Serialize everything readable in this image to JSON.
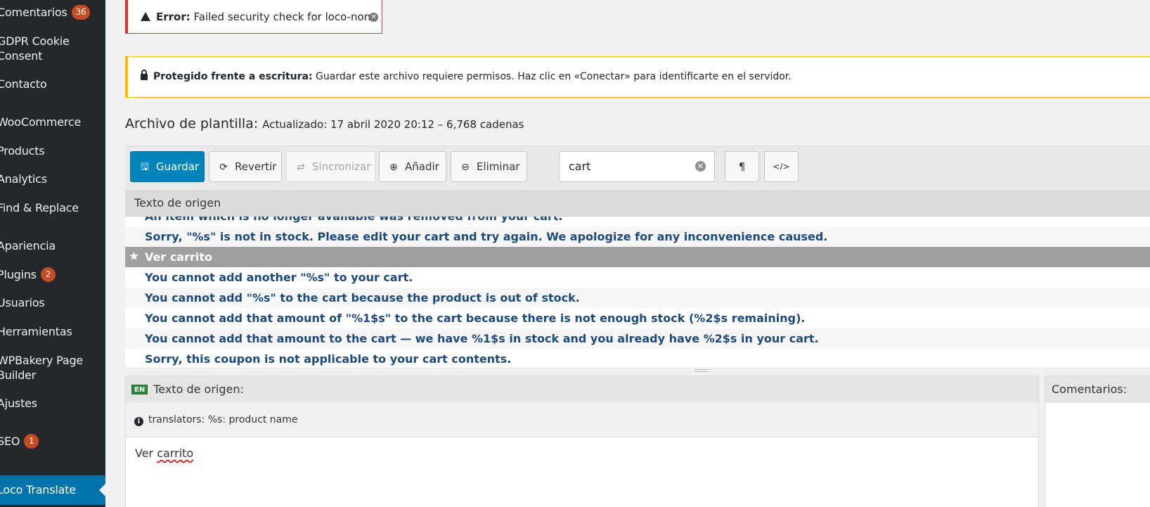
{
  "sidebar": {
    "items": [
      {
        "label": "Comentarios",
        "badge": "36"
      },
      {
        "label": "GDPR Cookie",
        "label2": "Consent"
      },
      {
        "label": "Contacto"
      },
      {
        "label": "WooCommerce"
      },
      {
        "label": "Products"
      },
      {
        "label": "Analytics"
      },
      {
        "label": "Find & Replace"
      },
      {
        "label": "Apariencia"
      },
      {
        "label": "Plugins",
        "badge": "2"
      },
      {
        "label": "Usuarios"
      },
      {
        "label": "Herramientas"
      },
      {
        "label": "WPBakery Page",
        "label2": "Builder"
      },
      {
        "label": "Ajustes"
      },
      {
        "label": "SEO",
        "badge": "1"
      },
      {
        "label": "Loco Translate"
      }
    ]
  },
  "notices": {
    "error_label": "Error:",
    "error_text": "Failed security check for loco-non",
    "warn_label": "Protegido frente a escritura:",
    "warn_text": "Guardar este archivo requiere permisos. Haz clic en «Conectar» para identificarte en el servidor."
  },
  "file": {
    "label": "Archivo de plantilla:",
    "meta": "Actualizado: 17 abril 2020 20:12 – 6,768 cadenas"
  },
  "toolbar": {
    "save": "Guardar",
    "revert": "Revertir",
    "sync": "Sincronizar",
    "add": "Añadir",
    "delete": "Eliminar",
    "search_value": "cart",
    "pilcrow": "¶",
    "code": "</>"
  },
  "list": {
    "header": "Texto de origen",
    "partial_row": "An item which is no longer available was removed from your cart.",
    "rows": [
      "Sorry, \"%s\" is not in stock. Please edit your cart and try again. We apologize for any inconvenience caused.",
      "Ver carrito",
      "You cannot add another \"%s\" to your cart.",
      "You cannot add \"%s\" to the cart because the product is out of stock.",
      "You cannot add that amount of \"%1$s\" to the cart because there is not enough stock (%2$s remaining).",
      "You cannot add that amount to the cart — we have %1$s in stock and you already have %2$s in your cart.",
      "Sorry, this coupon is not applicable to your cart contents."
    ]
  },
  "editor": {
    "lang": "EN",
    "source_header": "Texto de origen:",
    "hint": "translators: %s: product name",
    "source_text_a": "Ver ",
    "source_text_b": "carrito",
    "comments_header": "Comentarios:"
  }
}
